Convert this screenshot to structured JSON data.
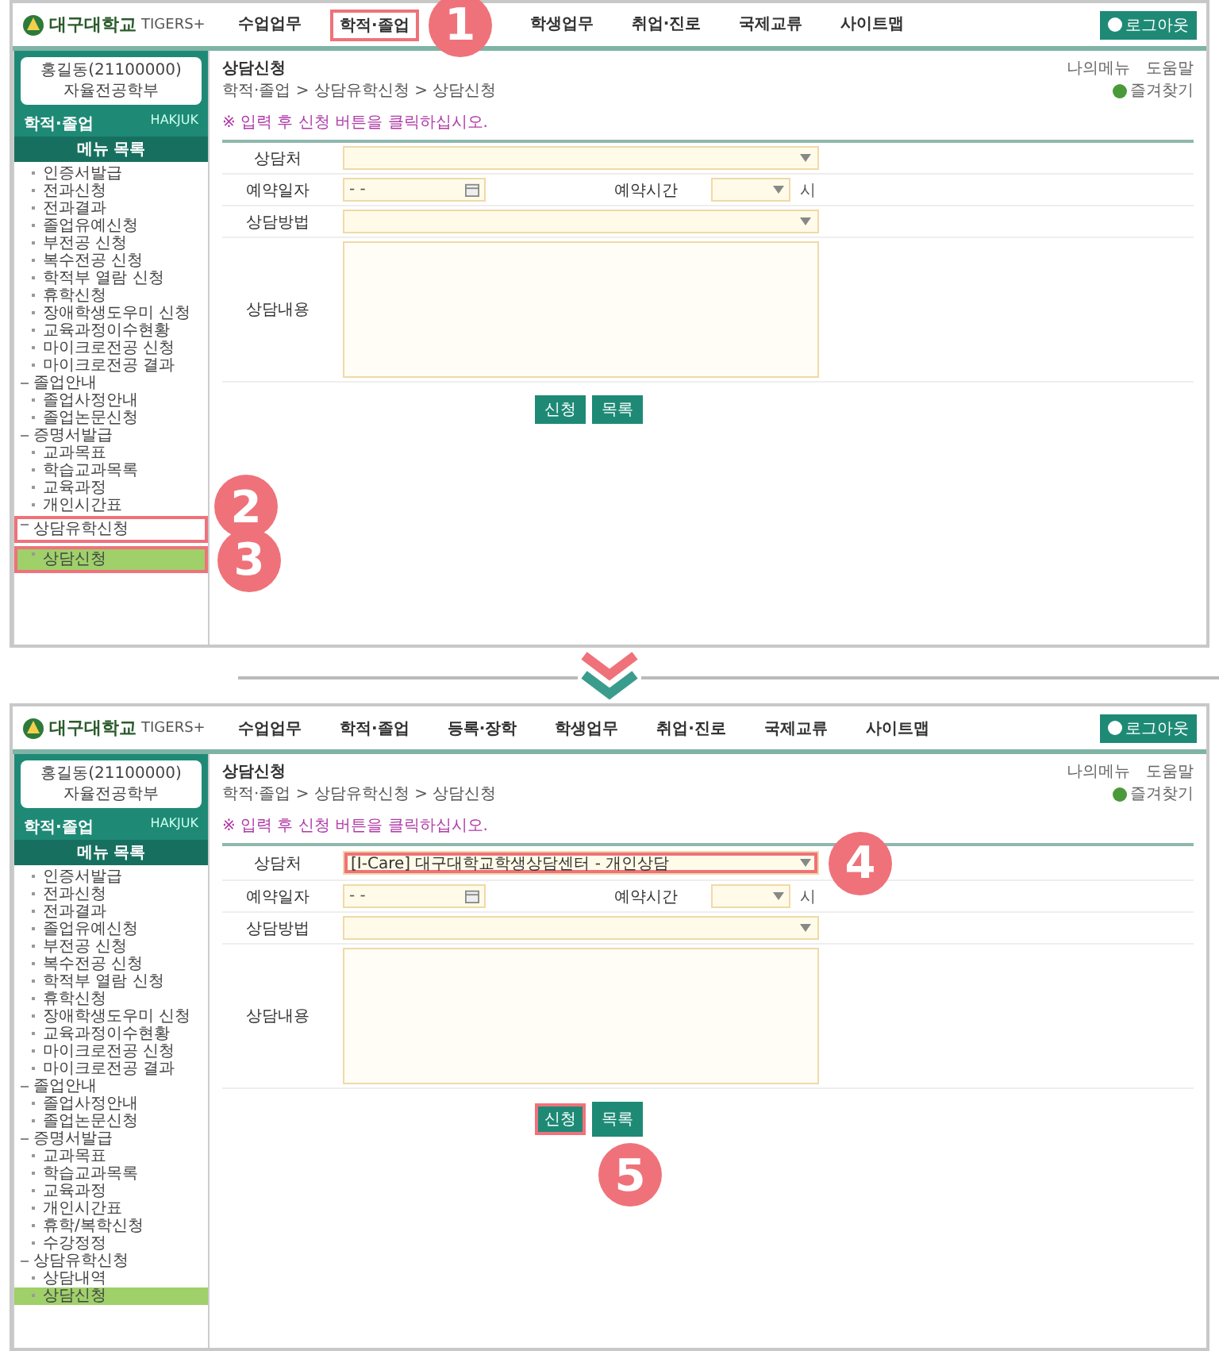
{
  "panels": [
    {
      "header": {
        "logo_text": "대구대학교",
        "logo_sub": "TIGERS+",
        "logout": "로그아웃",
        "nav": [
          {
            "label": "수업업무"
          },
          {
            "label": "학적·졸업",
            "highlighted": true,
            "marker": "1"
          },
          {
            "label": "학생업무"
          },
          {
            "label": "취업·진로"
          },
          {
            "label": "국제교류"
          },
          {
            "label": "사이트맵"
          }
        ]
      },
      "sidebar": {
        "user_id": "홍길동(21100000)",
        "user_dept": "자율전공학부",
        "section_title": "학적·졸업",
        "section_sub": "HAKJUK",
        "menu_title": "메뉴 목록",
        "menu": [
          {
            "label": "인증서발급",
            "kind": "item",
            "selected": false
          },
          {
            "label": "전과신청",
            "kind": "item",
            "selected": false
          },
          {
            "label": "전과결과",
            "kind": "item",
            "selected": false
          },
          {
            "label": "졸업유예신청",
            "kind": "item",
            "selected": false
          },
          {
            "label": "부전공 신청",
            "kind": "item",
            "selected": false
          },
          {
            "label": "복수전공 신청",
            "kind": "item",
            "selected": false
          },
          {
            "label": "학적부 열람 신청",
            "kind": "item",
            "selected": false
          },
          {
            "label": "휴학신청",
            "kind": "item",
            "selected": false
          },
          {
            "label": "장애학생도우미 신청",
            "kind": "item",
            "selected": false
          },
          {
            "label": "교육과정이수현황",
            "kind": "item",
            "selected": false
          },
          {
            "label": "마이크로전공 신청",
            "kind": "item",
            "selected": false
          },
          {
            "label": "마이크로전공 결과",
            "kind": "item",
            "selected": false
          },
          {
            "label": "졸업안내",
            "kind": "group",
            "children": [
              {
                "label": "졸업사정안내",
                "kind": "item",
                "selected": false
              },
              {
                "label": "졸업논문신청",
                "kind": "item",
                "selected": false
              }
            ]
          },
          {
            "label": "증명서발급",
            "kind": "group",
            "children": [
              {
                "label": "교과목표",
                "kind": "item",
                "selected": false
              },
              {
                "label": "학습교과목록",
                "kind": "item",
                "selected": false
              },
              {
                "label": "교육과정",
                "kind": "item",
                "selected": false
              },
              {
                "label": "개인시간표",
                "kind": "item",
                "selected": false
              }
            ]
          },
          {
            "label": "상담유학신청",
            "kind": "group",
            "highlighted": true,
            "marker": "2",
            "children": [
              {
                "label": "상담신청",
                "kind": "item",
                "selected": true,
                "highlighted": true,
                "marker": "3"
              }
            ]
          }
        ]
      },
      "content": {
        "tab": "상담신청",
        "breadcrumb": "학적·졸업 > 상담유학신청 > 상담신청",
        "links": [
          "나의메뉴",
          "도움말"
        ],
        "favorite": "즐겨찾기",
        "instruction": "※ 입력 후 신청 버튼을 클릭하십시오.",
        "fields": [
          {
            "label": "상담처",
            "kind": "select"
          },
          {
            "label": "예약일자",
            "kind": "date",
            "value": "- -",
            "time_label": "예약시간",
            "time_unit": "시"
          },
          {
            "label": "상담방법",
            "kind": "select"
          },
          {
            "label": "상담내용",
            "kind": "textarea"
          }
        ],
        "buttons": [
          {
            "label": "신청"
          },
          {
            "label": "목록"
          }
        ]
      }
    },
    {
      "header": {
        "logo_text": "대구대학교",
        "logo_sub": "TIGERS+",
        "logout": "로그아웃",
        "nav": [
          {
            "label": "수업업무"
          },
          {
            "label": "학적·졸업"
          },
          {
            "label": "등록·장학"
          },
          {
            "label": "학생업무"
          },
          {
            "label": "취업·진로"
          },
          {
            "label": "국제교류"
          },
          {
            "label": "사이트맵"
          }
        ]
      },
      "sidebar": {
        "user_id": "홍길동(21100000)",
        "user_dept": "자율전공학부",
        "section_title": "학적·졸업",
        "section_sub": "HAKJUK",
        "menu_title": "메뉴 목록",
        "menu": [
          {
            "label": "인증서발급",
            "kind": "item",
            "selected": false
          },
          {
            "label": "전과신청",
            "kind": "item",
            "selected": false
          },
          {
            "label": "전과결과",
            "kind": "item",
            "selected": false
          },
          {
            "label": "졸업유예신청",
            "kind": "item",
            "selected": false
          },
          {
            "label": "부전공 신청",
            "kind": "item",
            "selected": false
          },
          {
            "label": "복수전공 신청",
            "kind": "item",
            "selected": false
          },
          {
            "label": "학적부 열람 신청",
            "kind": "item",
            "selected": false
          },
          {
            "label": "휴학신청",
            "kind": "item",
            "selected": false
          },
          {
            "label": "장애학생도우미 신청",
            "kind": "item",
            "selected": false
          },
          {
            "label": "교육과정이수현황",
            "kind": "item",
            "selected": false
          },
          {
            "label": "마이크로전공 신청",
            "kind": "item",
            "selected": false
          },
          {
            "label": "마이크로전공 결과",
            "kind": "item",
            "selected": false
          },
          {
            "label": "졸업안내",
            "kind": "group",
            "children": [
              {
                "label": "졸업사정안내",
                "kind": "item",
                "selected": false
              },
              {
                "label": "졸업논문신청",
                "kind": "item",
                "selected": false
              }
            ]
          },
          {
            "label": "증명서발급",
            "kind": "group",
            "children": [
              {
                "label": "교과목표",
                "kind": "item",
                "selected": false
              },
              {
                "label": "학습교과목록",
                "kind": "item",
                "selected": false
              },
              {
                "label": "교육과정",
                "kind": "item",
                "selected": false
              },
              {
                "label": "개인시간표",
                "kind": "item",
                "selected": false
              },
              {
                "label": "휴학/복학신청",
                "kind": "item",
                "selected": false
              },
              {
                "label": "수강정정",
                "kind": "item",
                "selected": false
              }
            ]
          },
          {
            "label": "상담유학신청",
            "kind": "group",
            "children": [
              {
                "label": "상담내역",
                "kind": "item",
                "selected": false
              },
              {
                "label": "상담신청",
                "kind": "item",
                "selected": true
              }
            ]
          }
        ]
      },
      "content": {
        "tab": "상담신청",
        "breadcrumb": "학적·졸업 > 상담유학신청 > 상담신청",
        "links": [
          "나의메뉴",
          "도움말"
        ],
        "favorite": "즐겨찾기",
        "instruction": "※ 입력 후 신청 버튼을 클릭하십시오.",
        "fields": [
          {
            "label": "상담처",
            "kind": "select",
            "value": "[I-Care] 대구대학교학생상담센터 - 개인상담",
            "highlighted": true,
            "marker": "4"
          },
          {
            "label": "예약일자",
            "kind": "date",
            "value": "- -",
            "time_label": "예약시간",
            "time_unit": "시"
          },
          {
            "label": "상담방법",
            "kind": "select"
          },
          {
            "label": "상담내용",
            "kind": "textarea"
          }
        ],
        "buttons": [
          {
            "label": "신청",
            "highlighted": true,
            "marker": "5"
          },
          {
            "label": "목록"
          }
        ]
      }
    }
  ]
}
